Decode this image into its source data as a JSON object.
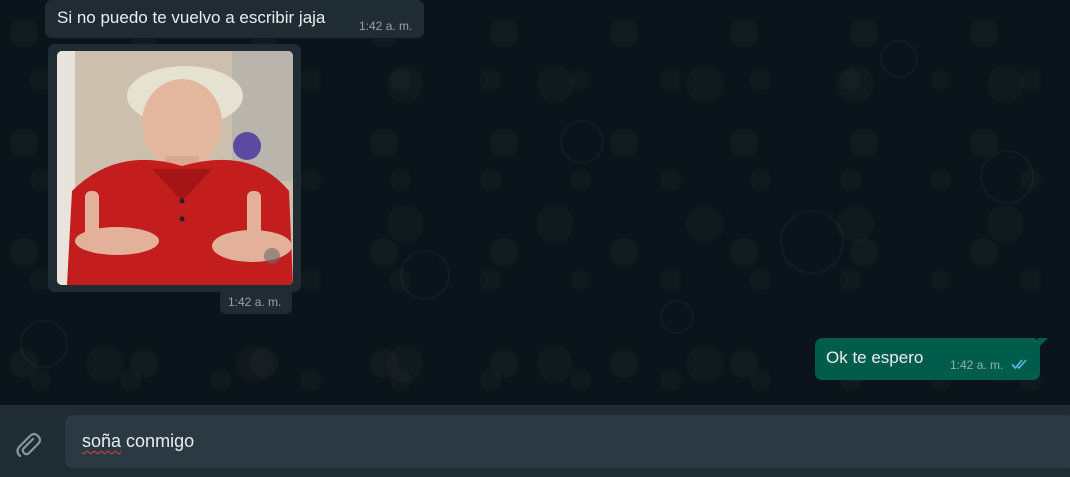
{
  "messages": {
    "incoming_text": {
      "text": "Si no puedo te vuelvo a escribir jaja",
      "time": "1:42 a. m."
    },
    "incoming_image": {
      "time": "1:42 a. m."
    },
    "outgoing_text": {
      "text": "Ok te espero",
      "time": "1:42 a. m.",
      "status_icon": "double-check-icon"
    }
  },
  "composer": {
    "attach_icon": "paperclip-icon",
    "typed_word_misspelled": "soña",
    "typed_rest": " conmigo"
  },
  "colors": {
    "chat_background": "#0b141a",
    "incoming_bubble": "#202c33",
    "outgoing_bubble": "#005c4b",
    "footer_background": "#202c33",
    "input_background": "#2a3942",
    "read_tick": "#53bdeb"
  }
}
